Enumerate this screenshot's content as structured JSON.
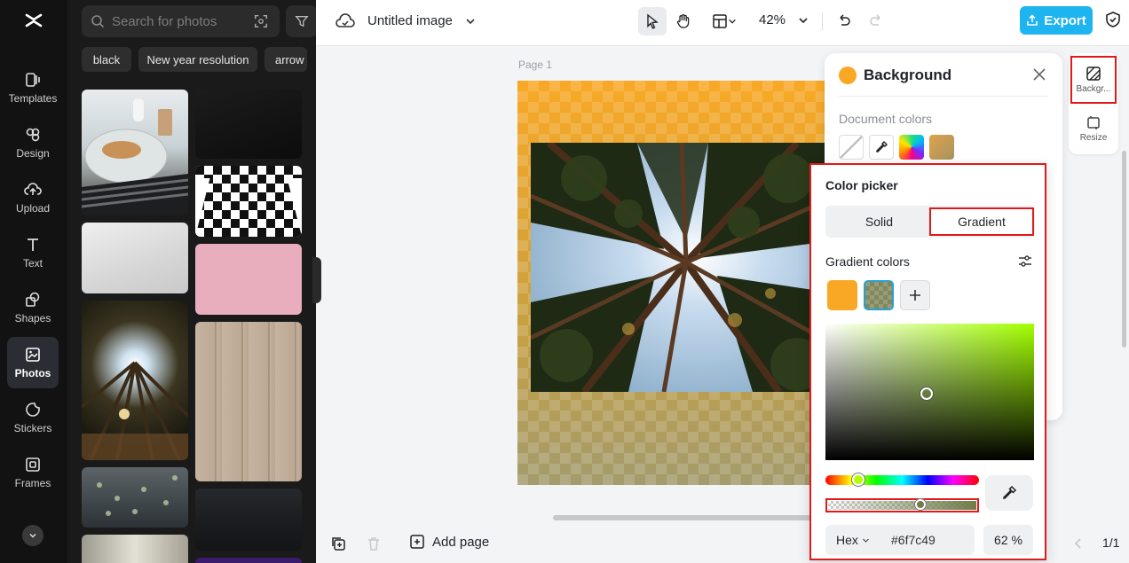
{
  "rail": {
    "items": [
      {
        "label": "Templates",
        "icon": "templates-icon"
      },
      {
        "label": "Design",
        "icon": "design-icon"
      },
      {
        "label": "Upload",
        "icon": "upload-icon"
      },
      {
        "label": "Text",
        "icon": "text-icon"
      },
      {
        "label": "Shapes",
        "icon": "shapes-icon"
      },
      {
        "label": "Photos",
        "icon": "photos-icon"
      },
      {
        "label": "Stickers",
        "icon": "stickers-icon"
      },
      {
        "label": "Frames",
        "icon": "frames-icon"
      }
    ]
  },
  "photos_panel": {
    "search_placeholder": "Search for photos",
    "chips": [
      "black",
      "New year resolution",
      "arrow"
    ]
  },
  "topbar": {
    "title": "Untitled image",
    "zoom": "42%",
    "export_label": "Export"
  },
  "canvas": {
    "page_label": "Page 1"
  },
  "bottombar": {
    "add_page_label": "Add page",
    "page_counter": "1/1"
  },
  "side_tools": {
    "background_label": "Backgr...",
    "resize_label": "Resize"
  },
  "background_panel": {
    "title": "Background",
    "document_colors_label": "Document colors"
  },
  "color_picker": {
    "title": "Color picker",
    "solid_label": "Solid",
    "gradient_label": "Gradient",
    "gradient_colors_label": "Gradient colors",
    "gradient_stops": [
      "#f9a825",
      "#6f7c49"
    ],
    "hex_mode": "Hex",
    "hex_value": "#6f7c49",
    "opacity": "62 %"
  },
  "colors": {
    "accent": "#1eb4f0",
    "highlight": "#e01919"
  }
}
